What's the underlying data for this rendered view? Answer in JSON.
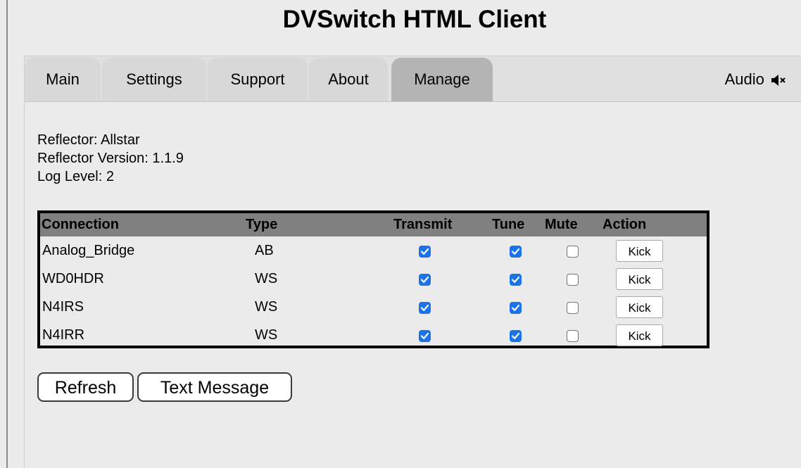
{
  "app": {
    "title": "DVSwitch HTML Client"
  },
  "tabs": [
    {
      "label": "Main",
      "active": false
    },
    {
      "label": "Settings",
      "active": false
    },
    {
      "label": "Support",
      "active": false
    },
    {
      "label": "About",
      "active": false
    },
    {
      "label": "Manage",
      "active": true
    }
  ],
  "audio": {
    "label": "Audio",
    "icon": "speaker-muted-icon"
  },
  "reflector_info": {
    "reflector": "Reflector: Allstar",
    "version": "Reflector Version: 1.1.9",
    "log_level": "Log Level: 2"
  },
  "connections_table": {
    "headers": {
      "connection": "Connection",
      "type": "Type",
      "transmit": "Transmit",
      "tune": "Tune",
      "mute": "Mute",
      "action": "Action"
    },
    "rows": [
      {
        "connection": "Analog_Bridge",
        "type": "AB",
        "transmit": true,
        "tune": true,
        "mute": false,
        "action": "Kick"
      },
      {
        "connection": "WD0HDR",
        "type": "WS",
        "transmit": true,
        "tune": true,
        "mute": false,
        "action": "Kick"
      },
      {
        "connection": "N4IRS",
        "type": "WS",
        "transmit": true,
        "tune": true,
        "mute": false,
        "action": "Kick"
      },
      {
        "connection": "N4IRR",
        "type": "WS",
        "transmit": true,
        "tune": true,
        "mute": false,
        "action": "Kick"
      }
    ]
  },
  "buttons": {
    "refresh": "Refresh",
    "text_message": "Text Message"
  },
  "colors": {
    "background": "#ebebeb",
    "tab": "#d8d8d8",
    "tab_active": "#b4b4b4",
    "table_header": "#808080",
    "checkbox_checked": "#1a73e8"
  }
}
